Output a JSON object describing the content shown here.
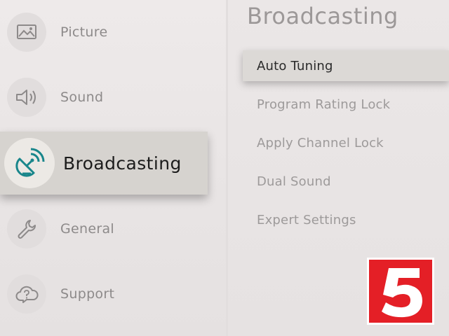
{
  "sidebar": {
    "items": [
      {
        "label": "Picture",
        "icon": "picture-icon"
      },
      {
        "label": "Sound",
        "icon": "speaker-icon"
      },
      {
        "label": "Broadcasting",
        "icon": "satellite-dish-icon",
        "selected": true
      },
      {
        "label": "General",
        "icon": "wrench-icon"
      },
      {
        "label": "Support",
        "icon": "support-cloud-icon"
      }
    ]
  },
  "main": {
    "title": "Broadcasting",
    "menu": [
      {
        "label": "Auto Tuning",
        "selected": true
      },
      {
        "label": "Program Rating Lock"
      },
      {
        "label": "Apply Channel Lock"
      },
      {
        "label": "Dual Sound"
      },
      {
        "label": "Expert Settings"
      }
    ]
  },
  "logo": {
    "text": "5"
  },
  "colors": {
    "accent": "#19868b",
    "logo_red": "#e41f26"
  }
}
